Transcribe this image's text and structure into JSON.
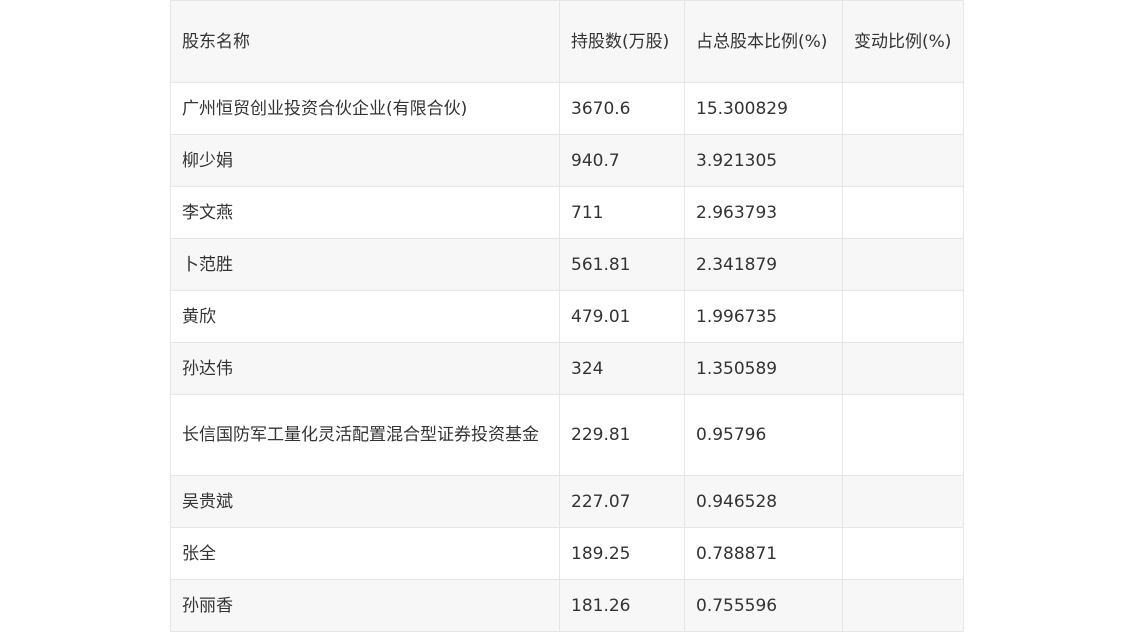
{
  "table": {
    "headers": [
      "股东名称",
      "持股数(万股)",
      "占总股本比例(%)",
      "变动比例(%)"
    ],
    "rows": [
      {
        "name": "广州恒贸创业投资合伙企业(有限合伙)",
        "shares": "3670.6",
        "ratio": "15.300829",
        "change": ""
      },
      {
        "name": "柳少娟",
        "shares": "940.7",
        "ratio": "3.921305",
        "change": ""
      },
      {
        "name": "李文燕",
        "shares": "711",
        "ratio": "2.963793",
        "change": ""
      },
      {
        "name": "卜范胜",
        "shares": "561.81",
        "ratio": "2.341879",
        "change": ""
      },
      {
        "name": "黄欣",
        "shares": "479.01",
        "ratio": "1.996735",
        "change": ""
      },
      {
        "name": "孙达伟",
        "shares": "324",
        "ratio": "1.350589",
        "change": ""
      },
      {
        "name": "长信国防军工量化灵活配置混合型证券投资基金",
        "shares": "229.81",
        "ratio": "0.95796",
        "change": ""
      },
      {
        "name": "吴贵斌",
        "shares": "227.07",
        "ratio": "0.946528",
        "change": ""
      },
      {
        "name": "张全",
        "shares": "189.25",
        "ratio": "0.788871",
        "change": ""
      },
      {
        "name": "孙丽香",
        "shares": "181.26",
        "ratio": "0.755596",
        "change": ""
      }
    ]
  }
}
